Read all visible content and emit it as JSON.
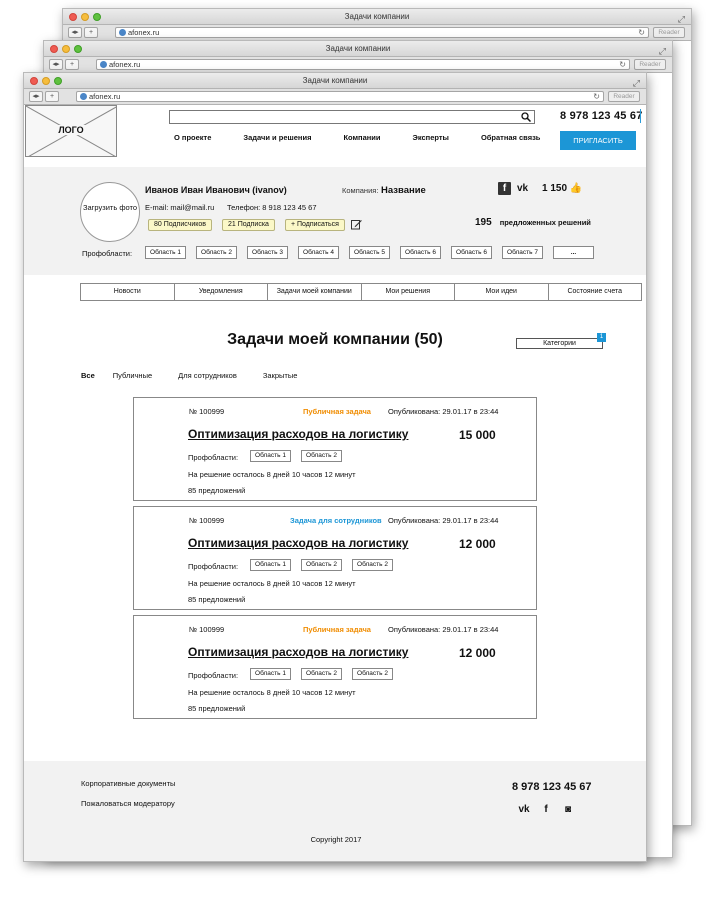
{
  "browser": {
    "title": "Задачи компании",
    "url": "afonex.ru",
    "reader": "Reader"
  },
  "header": {
    "logo": "ЛОГО",
    "phone": "8 978 123 45 67",
    "nav": [
      "О проекте",
      "Задачи и решения",
      "Компании",
      "Эксперты",
      "Обратная связь"
    ],
    "invite": "ПРИГЛАСИТЬ"
  },
  "profile": {
    "avatar": "Загрузить фото",
    "name": "Иванов Иван Иванович (ivanov)",
    "company_label": "Компания:",
    "company_name": "Название",
    "email": "E-mail: mail@mail.ru",
    "phone": "Телефон: 8 918 123 45 67",
    "likes": "1 150",
    "subscribers": "80 Подписчиков",
    "subscriptions": "21 Подписка",
    "subscribe": "+ Подписаться",
    "solutions_count": "195",
    "solutions_label": "предложенных решений",
    "areas_label": "Профобласти:",
    "areas": [
      "Область 1",
      "Область 2",
      "Область 3",
      "Область 4",
      "Область 5",
      "Область 6",
      "Область 6",
      "Область 7"
    ],
    "more": "..."
  },
  "tabs": [
    "Новости",
    "Уведомления",
    "Задачи моей компании",
    "Мои решения",
    "Мои идеи",
    "Состояние счета"
  ],
  "main": {
    "title": "Задачи моей компании (50)",
    "categories": "Категории",
    "categories_count": "1",
    "filters": [
      "Все",
      "Публичные",
      "Для сотрудников",
      "Закрытые"
    ]
  },
  "tasks": [
    {
      "number": "№ 100999",
      "type": "Публичная задача",
      "type_color": "#f08c00",
      "published": "Опубликована: 29.01.17 в 23:44",
      "title": "Оптимизация расходов на логистику",
      "price": "15 000",
      "areas_label": "Профобласти:",
      "areas": [
        "Область 1",
        "Область 2"
      ],
      "time_left": "На решение осталось 8 дней 10 часов 12 минут",
      "offers": "85 предложений"
    },
    {
      "number": "№ 100999",
      "type": "Задача для сотрудников",
      "type_color": "#1c96d6",
      "published": "Опубликована: 29.01.17 в 23:44",
      "title": "Оптимизация расходов на логистику",
      "price": "12 000",
      "areas_label": "Профобласти:",
      "areas": [
        "Область 1",
        "Область 2",
        "Область 2"
      ],
      "time_left": "На решение осталось 8 дней 10 часов 12 минут",
      "offers": "85 предложений"
    },
    {
      "number": "№ 100999",
      "type": "Публичная задача",
      "type_color": "#f08c00",
      "published": "Опубликована: 29.01.17 в 23:44",
      "title": "Оптимизация расходов на логистику",
      "price": "12 000",
      "areas_label": "Профобласти:",
      "areas": [
        "Область 1",
        "Область 2",
        "Область 2"
      ],
      "time_left": "На решение осталось 8 дней 10 часов 12 минут",
      "offers": "85 предложений"
    }
  ],
  "footer": {
    "docs": "Корпоративные документы",
    "complain": "Пожаловаться модератору",
    "phone": "8 978 123 45 67",
    "copyright": "Copyright 2017"
  }
}
